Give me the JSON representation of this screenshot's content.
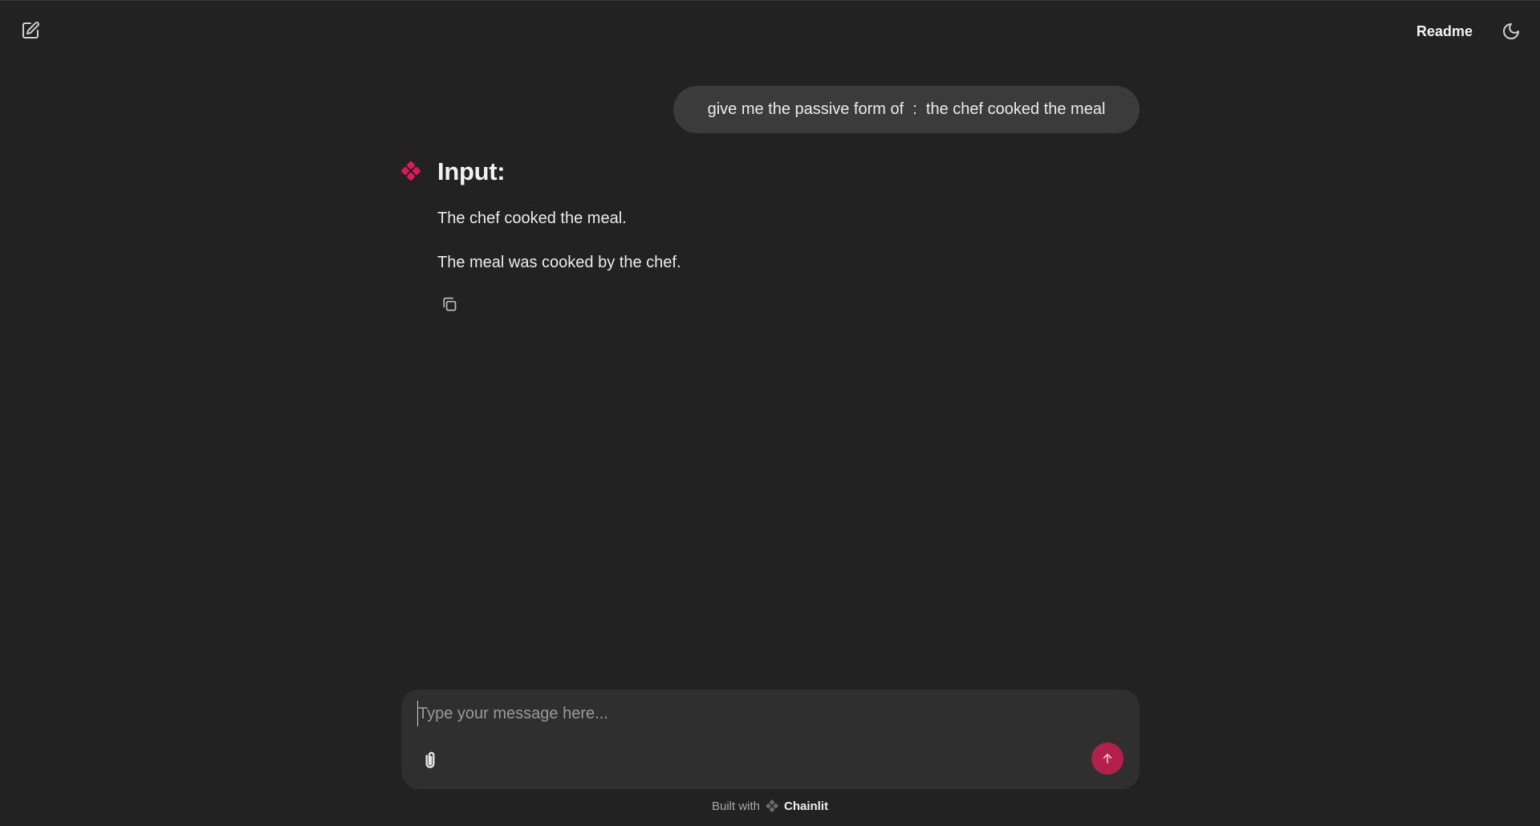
{
  "header": {
    "new_chat_icon": "edit-square-icon",
    "readme_label": "Readme",
    "theme_icon": "moon-icon"
  },
  "conversation": {
    "user_message": "give me the passive form of  :  the chef cooked the meal",
    "assistant": {
      "avatar_icon": "chainlit-logo-icon",
      "heading": "Input:",
      "line1": "The chef cooked the meal.",
      "line2": "The meal was cooked by the chef.",
      "copy_icon": "copy-icon"
    }
  },
  "composer": {
    "placeholder": "Type your message here...",
    "value": "",
    "attach_icon": "paperclip-icon",
    "send_icon": "arrow-up-icon"
  },
  "footer": {
    "built_with": "Built with",
    "brand": "Chainlit"
  },
  "colors": {
    "background": "#222222",
    "bubble": "#3b3b3b",
    "composer": "#2f2f2f",
    "accent": "#b3204b",
    "logo": "#e0185e"
  }
}
